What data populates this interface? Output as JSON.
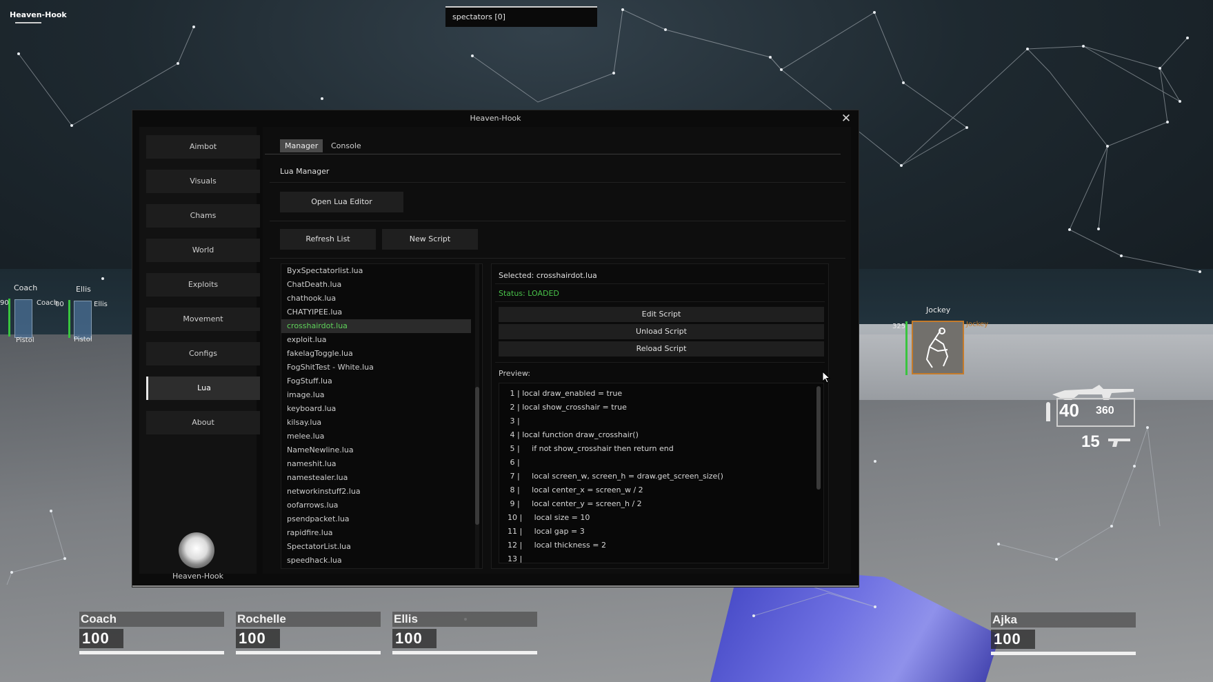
{
  "overlay": {
    "app_name": "Heaven-Hook",
    "spectators": "spectators [0]"
  },
  "window": {
    "title": "Heaven-Hook",
    "close_glyph": "✕"
  },
  "sidebar": {
    "items": [
      {
        "label": "Aimbot"
      },
      {
        "label": "Visuals"
      },
      {
        "label": "Chams"
      },
      {
        "label": "World"
      },
      {
        "label": "Exploits"
      },
      {
        "label": "Movement"
      },
      {
        "label": "Configs"
      },
      {
        "label": "Lua",
        "active": true
      },
      {
        "label": "About"
      }
    ],
    "brand": "Heaven-Hook"
  },
  "tabs": [
    {
      "label": "Manager",
      "active": true
    },
    {
      "label": "Console"
    }
  ],
  "lua_manager": {
    "title": "Lua Manager",
    "open_editor": "Open Lua Editor",
    "refresh_list": "Refresh List",
    "new_script": "New Script",
    "scripts": [
      "ByxSpectatorlist.lua",
      "ChatDeath.lua",
      "chathook.lua",
      "CHATYIPEE.lua",
      "crosshairdot.lua",
      "exploit.lua",
      "fakelagToggle.lua",
      "FogShitTest - White.lua",
      "FogStuff.lua",
      "image.lua",
      "keyboard.lua",
      "kilsay.lua",
      "melee.lua",
      "NameNewline.lua",
      "nameshit.lua",
      "namestealer.lua",
      "networkinstuff2.lua",
      "oofarrows.lua",
      "psendpacket.lua",
      "rapidfire.lua",
      "SpectatorList.lua",
      "speedhack.lua"
    ],
    "selected_index": 4,
    "detail": {
      "selected": "Selected: crosshairdot.lua",
      "status": "Status: LOADED",
      "edit": "Edit Script",
      "unload": "Unload Script",
      "reload": "Reload Script",
      "preview_label": "Preview:",
      "code": [
        " 1 | local draw_enabled = true",
        " 2 | local show_crosshair = true",
        " 3 |",
        " 4 | local function draw_crosshair()",
        " 5 |     if not show_crosshair then return end",
        " 6 |",
        " 7 |     local screen_w, screen_h = draw.get_screen_size()",
        " 8 |     local center_x = screen_w / 2",
        " 9 |     local center_y = screen_h / 2",
        "10 |     local size = 10",
        "11 |     local gap = 3",
        "12 |     local thickness = 2",
        "13 |"
      ]
    }
  },
  "hud": {
    "survivor_tags": [
      {
        "name": "Coach",
        "hp": "100",
        "weapon": "Pistol"
      },
      {
        "name": "Ellis",
        "hp": "100",
        "weapon": "Pistol"
      }
    ],
    "left_numbers": {
      "coach_side": "90",
      "ellis_side": "00"
    },
    "jockey": {
      "name": "Jockey",
      "hp": "325"
    },
    "team": [
      {
        "name": "Coach",
        "hp": "100"
      },
      {
        "name": "Rochelle",
        "hp": "100"
      },
      {
        "name": "Ellis",
        "hp": "100"
      },
      {
        "name": "Ajka",
        "hp": "100"
      }
    ],
    "ammo": {
      "clip": "40",
      "reserve": "360",
      "secondary": "15"
    },
    "colors": {
      "selected_script": "#5fd35a",
      "status_loaded": "#49c34a",
      "health": "#39c43f",
      "jockey_frame": "#c57b2a"
    }
  }
}
